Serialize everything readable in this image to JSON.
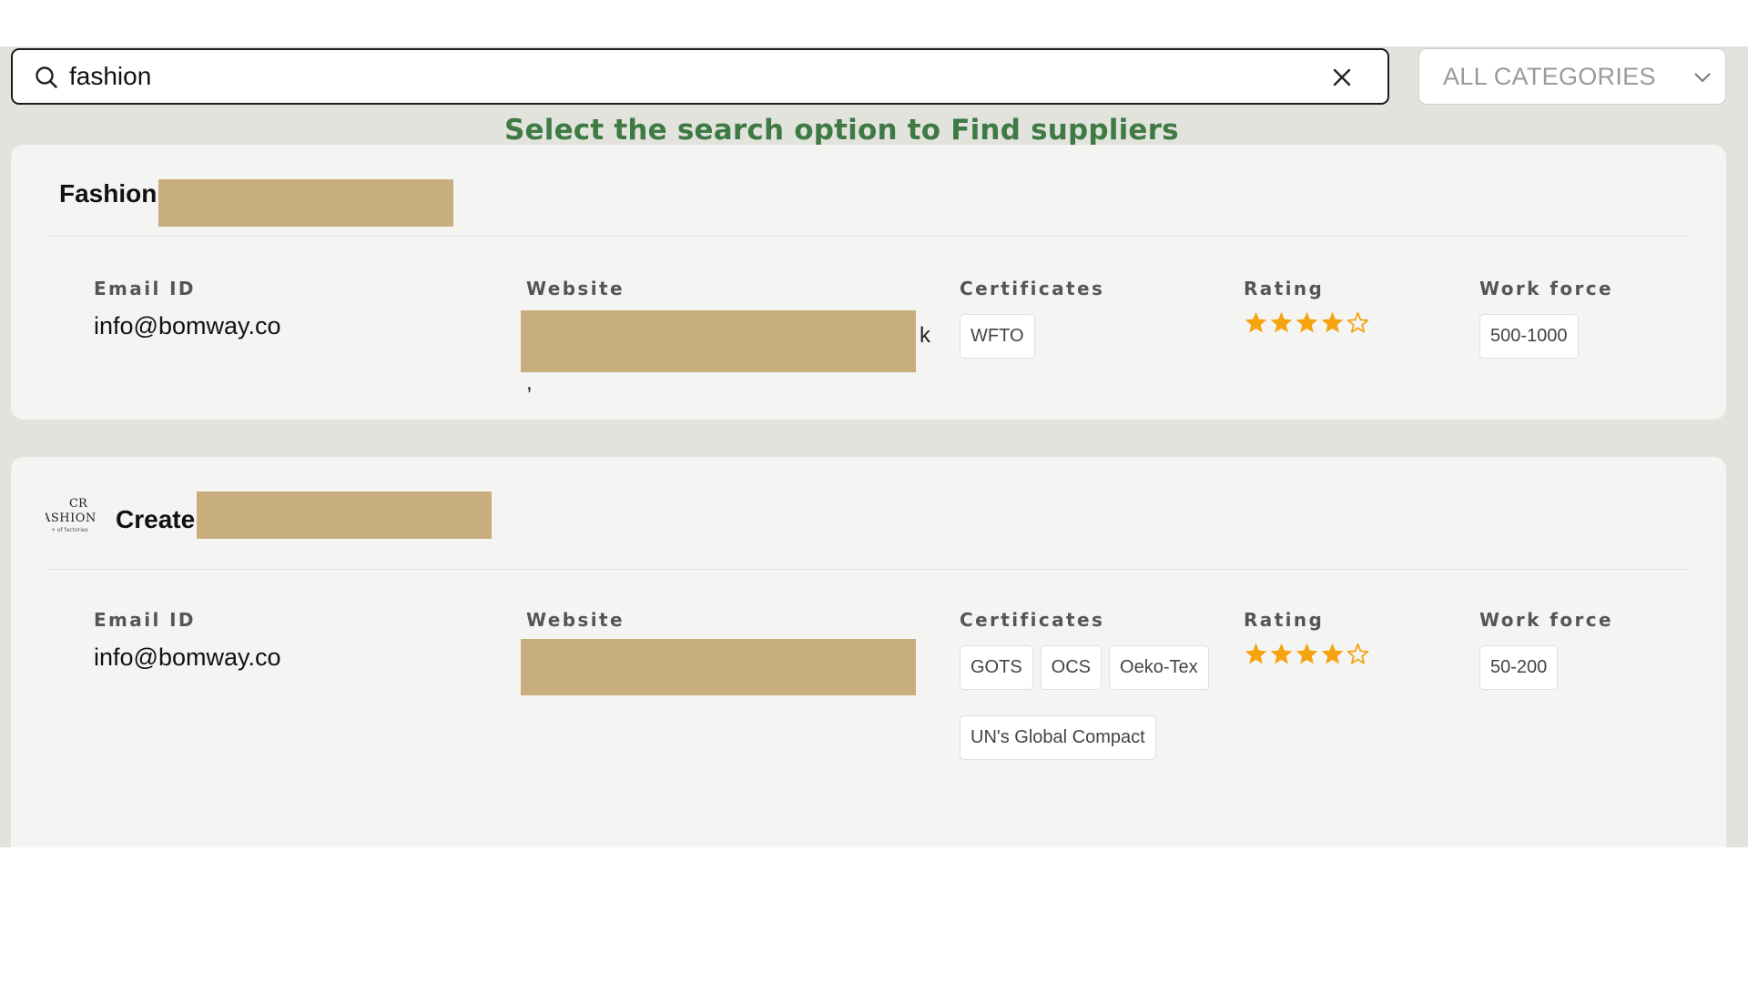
{
  "search": {
    "value": "fashion",
    "placeholder": ""
  },
  "category_select": {
    "selected": "ALL CATEGORIES"
  },
  "hint_text": "Select the search option to Find suppliers",
  "columns": {
    "email": "Email ID",
    "website": "Website",
    "certificates": "Certificates",
    "rating": "Rating",
    "workforce": "Work force"
  },
  "suppliers": [
    {
      "name": "Fashion",
      "email": "info@bomway.co",
      "certificates": [
        "WFTO"
      ],
      "rating": 4,
      "rating_max": 5,
      "workforce": "500-1000"
    },
    {
      "name": "Create",
      "logo_text": [
        "CR",
        "ASHION",
        "+ of factories"
      ],
      "email": "info@bomway.co",
      "certificates": [
        "GOTS",
        "OCS",
        "Oeko-Tex",
        "UN's Global Compact"
      ],
      "rating": 4,
      "rating_max": 5,
      "workforce": "50-200"
    }
  ],
  "colors": {
    "hint_green": "#3e7a44",
    "star_orange": "#f5a30f",
    "redaction": "#c8ae7d",
    "background": "#e3e3de",
    "card": "#f4f4f3"
  },
  "icons": {
    "search": "search-icon",
    "clear": "close-icon",
    "dropdown": "chevron-down-icon",
    "star_full": "star-filled-icon",
    "star_empty": "star-outline-icon"
  }
}
